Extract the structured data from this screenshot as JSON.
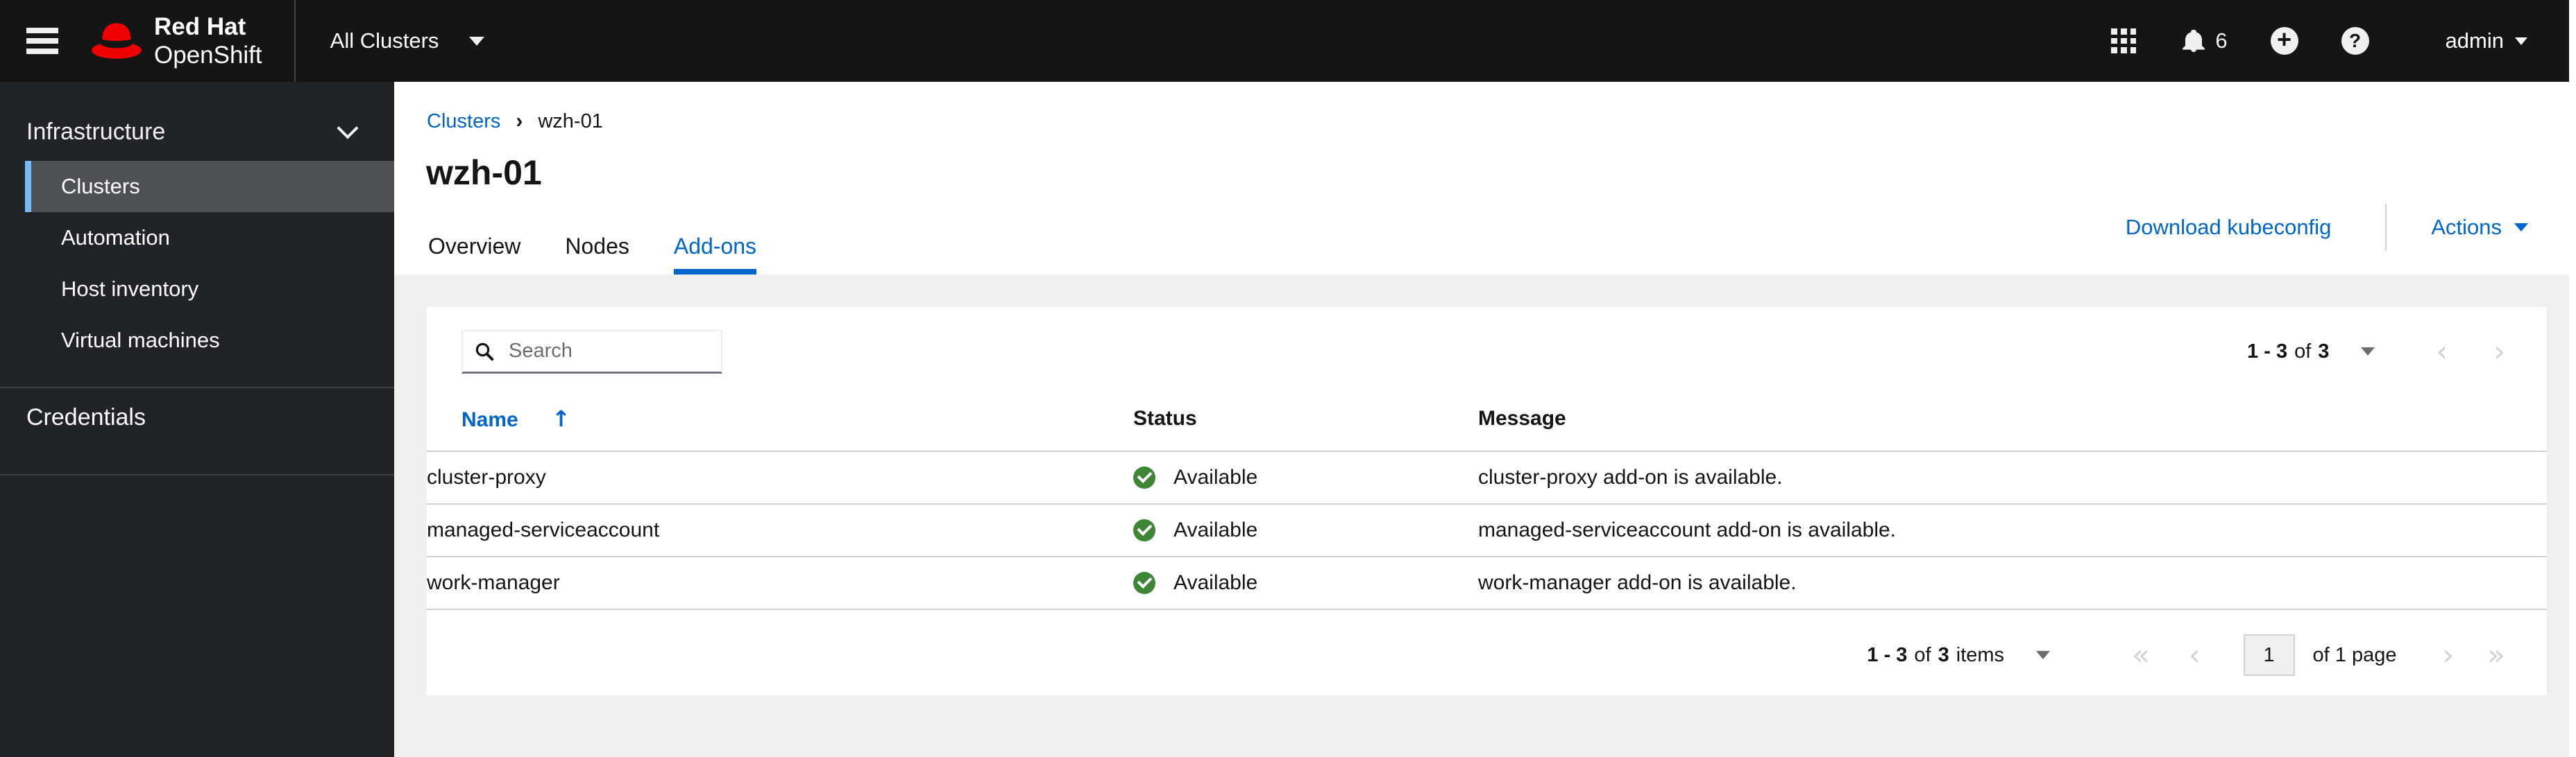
{
  "masthead": {
    "brand_line1": "Red Hat",
    "brand_line2": "OpenShift",
    "cluster_selector_label": "All Clusters",
    "notification_count": "6",
    "plus_glyph": "+",
    "help_glyph": "?",
    "user_name": "admin"
  },
  "sidebar": {
    "group_label": "Infrastructure",
    "items": [
      {
        "label": "Clusters",
        "selected": true
      },
      {
        "label": "Automation",
        "selected": false
      },
      {
        "label": "Host inventory",
        "selected": false
      },
      {
        "label": "Virtual machines",
        "selected": false
      }
    ],
    "secondary_label": "Credentials"
  },
  "page": {
    "breadcrumb": {
      "parent": "Clusters",
      "separator": "›",
      "current": "wzh-01"
    },
    "title": "wzh-01",
    "download_kubeconfig_label": "Download kubeconfig",
    "actions_label": "Actions",
    "tabs": [
      {
        "label": "Overview",
        "active": false
      },
      {
        "label": "Nodes",
        "active": false
      },
      {
        "label": "Add-ons",
        "active": true
      }
    ]
  },
  "card": {
    "search_placeholder": "Search",
    "top_pagination": {
      "range": "1 - 3",
      "of_word": "of",
      "total": "3",
      "prev_icon": "‹",
      "next_icon": "›"
    },
    "table": {
      "columns": {
        "name": "Name",
        "status": "Status",
        "message": "Message"
      },
      "sort_icon": "↑",
      "rows": [
        {
          "name": "cluster-proxy",
          "status": "Available",
          "message": "cluster-proxy add-on is available."
        },
        {
          "name": "managed-serviceaccount",
          "status": "Available",
          "message": "managed-serviceaccount add-on is available."
        },
        {
          "name": "work-manager",
          "status": "Available",
          "message": "work-manager add-on is available."
        }
      ]
    },
    "bottom_pagination": {
      "range": "1 - 3",
      "of_word": "of",
      "total": "3",
      "items_word": "items",
      "first_icon": "«",
      "prev_icon": "‹",
      "current_page": "1",
      "page_info": "of 1 page",
      "next_icon": "›",
      "last_icon": "»"
    }
  },
  "colors": {
    "accent_blue": "#0066cc",
    "success_green": "#3e8635",
    "nav_selected_accent": "#73bcf7",
    "masthead_bg": "#151515",
    "sidebar_bg": "#212427",
    "content_bg": "#f0f0f0"
  }
}
